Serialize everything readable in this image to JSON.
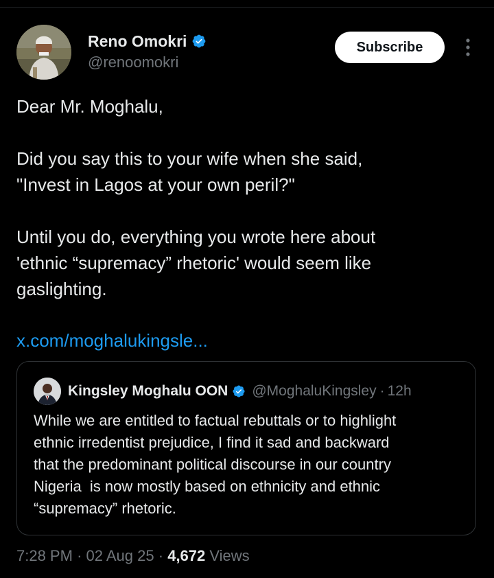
{
  "author": {
    "display_name": "Reno Omokri",
    "handle": "@renoomokri",
    "avatar_icon": "profile-photo",
    "verified_icon": "verified-badge-icon"
  },
  "actions": {
    "subscribe_label": "Subscribe",
    "more_icon": "more-vertical-icon"
  },
  "tweet": {
    "lines": [
      "Dear Mr. Moghalu,",
      "Did you say this to your wife when she said,",
      "\"Invest in Lagos at your own peril?\"",
      "Until you do, everything you wrote here about",
      "'ethnic “supremacy” rhetoric' would seem like",
      "gaslighting."
    ],
    "link": "x.com/moghalukingsle..."
  },
  "quote": {
    "display_name": "Kingsley Moghalu OON",
    "handle": "@MoghaluKingsley",
    "separator": "·",
    "time": "12h",
    "lines": [
      "While we are entitled to factual rebuttals or to highlight",
      "ethnic irredentist prejudice, I find it sad and backward",
      "that the predominant political discourse in our country",
      "Nigeria  is now mostly based on ethnicity and ethnic",
      "“supremacy” rhetoric."
    ]
  },
  "meta": {
    "time": "7:28 PM",
    "date": "02 Aug 25",
    "separator": "·",
    "views_count": "4,672",
    "views_label": "Views"
  },
  "colors": {
    "background": "#000000",
    "text": "#e7e9ea",
    "muted": "#71767b",
    "link": "#1d9bf0",
    "verified": "#1d9bf0",
    "border": "#2f3336"
  }
}
